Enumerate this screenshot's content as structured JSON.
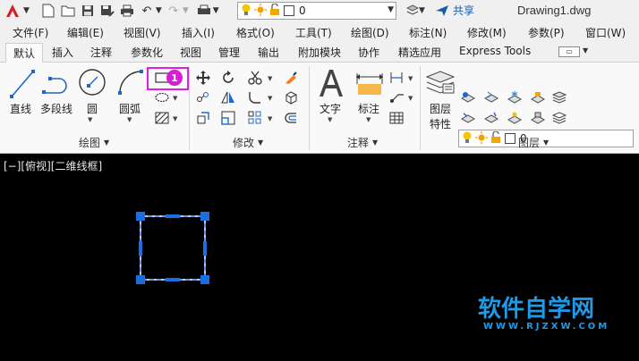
{
  "titlebar": {
    "layer_value": "0",
    "share_label": "共享",
    "doc_title": "Drawing1.dwg"
  },
  "menu": [
    "文件(F)",
    "编辑(E)",
    "视图(V)",
    "插入(I)",
    "格式(O)",
    "工具(T)",
    "绘图(D)",
    "标注(N)",
    "修改(M)",
    "参数(P)",
    "窗口(W)"
  ],
  "tabs": [
    "默认",
    "插入",
    "注释",
    "参数化",
    "视图",
    "管理",
    "输出",
    "附加模块",
    "协作",
    "精选应用",
    "Express Tools"
  ],
  "draw_panel": {
    "line_label": "直线",
    "polyline_label": "多段线",
    "circle_label": "圆",
    "arc_label": "圆弧",
    "title": "绘图",
    "step_badge": "1"
  },
  "modify_panel": {
    "title": "修改"
  },
  "annotation_panel": {
    "text_label": "文字",
    "dimension_label": "标注",
    "title": "注释"
  },
  "layers_panel": {
    "layer_props_label_1": "图层",
    "layer_props_label_2": "特性",
    "layer_value": "0",
    "title": "图层"
  },
  "viewport": {
    "label": "[−][俯视][二维线框]"
  },
  "watermark": {
    "text": "软件自学网",
    "url": "WWW.RJZXW.COM"
  },
  "colors": {
    "accent": "#1e9ae8",
    "highlight": "#e020e0",
    "selection": "#1a6fe0"
  }
}
